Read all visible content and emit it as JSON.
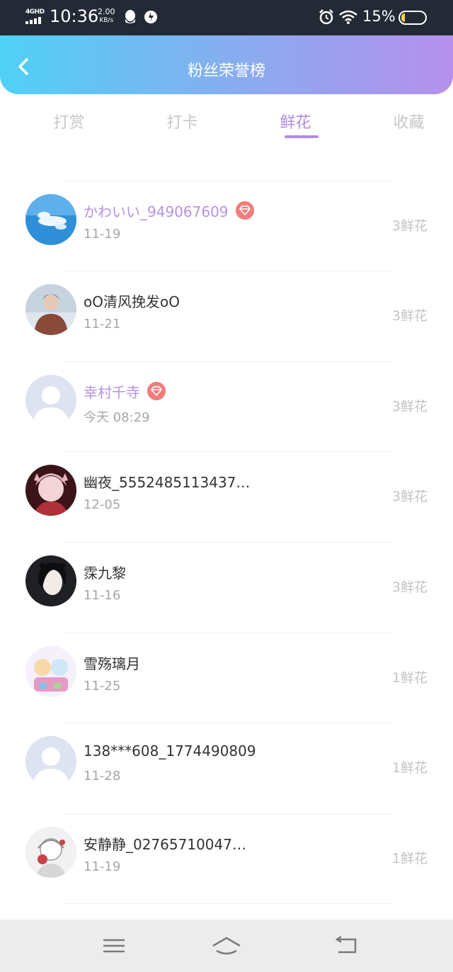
{
  "status_bar": {
    "network": "4GHD",
    "time": "10:36",
    "speed_value": "2.00",
    "speed_unit": "KB/s",
    "battery_percent": "15%",
    "battery_level": 0.15,
    "icons": [
      "qq-icon",
      "app-icon",
      "alarm-icon",
      "wifi-icon",
      "battery-icon"
    ]
  },
  "header": {
    "title": "粉丝荣誉榜",
    "back_icon": "chevron-left-icon"
  },
  "tabs": [
    {
      "label": "打赏",
      "active": false
    },
    {
      "label": "打卡",
      "active": false
    },
    {
      "label": "鲜花",
      "active": true
    },
    {
      "label": "收藏",
      "active": false
    }
  ],
  "fans": [
    {
      "name": "",
      "date": "12-05",
      "count": "3鲜花",
      "vip": false,
      "avatar": "default"
    },
    {
      "name": "かわいい_949067609",
      "date": "11-19",
      "count": "3鲜花",
      "vip": true,
      "avatar": "sky"
    },
    {
      "name": "oO清风挽发oO",
      "date": "11-21",
      "count": "3鲜花",
      "vip": false,
      "avatar": "person"
    },
    {
      "name": "幸村千寺",
      "date": "今天 08:29",
      "count": "3鲜花",
      "vip": true,
      "avatar": "default"
    },
    {
      "name": "幽夜_5552485113437…",
      "date": "12-05",
      "count": "3鲜花",
      "vip": false,
      "avatar": "anime-red"
    },
    {
      "name": "霂九黎",
      "date": "11-16",
      "count": "3鲜花",
      "vip": false,
      "avatar": "anime-dark"
    },
    {
      "name": "雪殇璃月",
      "date": "11-25",
      "count": "1鲜花",
      "vip": false,
      "avatar": "anime-colorful"
    },
    {
      "name": "138***608_1774490809",
      "date": "11-28",
      "count": "1鲜花",
      "vip": false,
      "avatar": "default"
    },
    {
      "name": "安静静_02765710047…",
      "date": "11-19",
      "count": "1鲜花",
      "vip": false,
      "avatar": "anime-sketch"
    }
  ],
  "nav_bar": {
    "icons": [
      "menu-icon",
      "home-icon",
      "back-icon"
    ]
  },
  "colors": {
    "accent": "#b28be0",
    "vip_name": "#b891e3",
    "vip_badge": "#f07c7c",
    "header_gradient_start": "#4fd1f6",
    "header_gradient_end": "#b690ec"
  }
}
